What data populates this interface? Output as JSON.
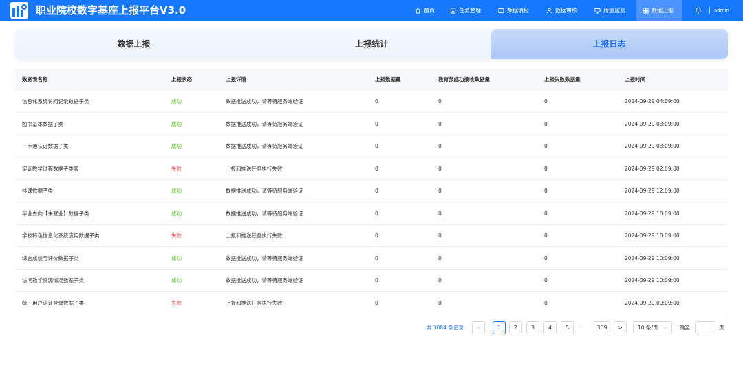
{
  "header": {
    "title": "职业院校数字基座上报平台V3.0",
    "nav": [
      {
        "label": "首页",
        "icon": "home-icon"
      },
      {
        "label": "任务管理",
        "icon": "task-icon"
      },
      {
        "label": "数据填报",
        "icon": "form-icon"
      },
      {
        "label": "数据审核",
        "icon": "user-check-icon"
      },
      {
        "label": "质量监测",
        "icon": "monitor-icon"
      },
      {
        "label": "数据上报",
        "icon": "upload-icon"
      }
    ],
    "active_nav": "数据上报",
    "user": "admin",
    "brand_color": "#1677ff"
  },
  "tabs": [
    {
      "label": "数据上报"
    },
    {
      "label": "上报统计"
    },
    {
      "label": "上报日志"
    }
  ],
  "active_tab": "上报日志",
  "table": {
    "columns": [
      "数据表名称",
      "上报状态",
      "上报详情",
      "上报数据量",
      "教育部成功接收数据量",
      "上报失败数据量",
      "上报时间"
    ],
    "rows": [
      {
        "name": "信息化系统访问记录数据子类",
        "status": "成功",
        "detail": "数据推送成功，请等待服务端验证",
        "count": "0",
        "received": "0",
        "failed": "0",
        "time": "2024-09-29 04:09:00"
      },
      {
        "name": "图书基本数据子类",
        "status": "成功",
        "detail": "数据推送成功，请等待服务端验证",
        "count": "0",
        "received": "0",
        "failed": "0",
        "time": "2024-09-29 03:09:00"
      },
      {
        "name": "一卡通认证数据子类",
        "status": "成功",
        "detail": "数据推送成功，请等待服务端验证",
        "count": "0",
        "received": "0",
        "failed": "0",
        "time": "2024-09-29 03:09:00"
      },
      {
        "name": "实训教学过程数据子类表",
        "status": "失败",
        "detail": "上报和推送任务执行失败",
        "count": "0",
        "received": "0",
        "failed": "0",
        "time": "2024-09-29 02:09:00"
      },
      {
        "name": "排课数据子类",
        "status": "成功",
        "detail": "数据推送成功，请等待服务端验证",
        "count": "0",
        "received": "0",
        "failed": "0",
        "time": "2024-09-29 12:09:00"
      },
      {
        "name": "毕业去向【未就业】数据子类",
        "status": "成功",
        "detail": "数据推送成功，请等待服务端验证",
        "count": "0",
        "received": "0",
        "failed": "0",
        "time": "2024-09-29 10:09:00"
      },
      {
        "name": "学校特色信息化系统应用数据子类",
        "status": "失败",
        "detail": "上报和推送任务执行失败",
        "count": "0",
        "received": "0",
        "failed": "0",
        "time": "2024-09-29 10:09:00"
      },
      {
        "name": "综合成绩与评价数据子类",
        "status": "成功",
        "detail": "数据推送成功，请等待服务端验证",
        "count": "0",
        "received": "0",
        "failed": "0",
        "time": "2024-09-29 10:09:00"
      },
      {
        "name": "访问教学资源情况数据子类",
        "status": "成功",
        "detail": "数据推送成功，请等待服务端验证",
        "count": "0",
        "received": "0",
        "failed": "0",
        "time": "2024-09-29 10:09:00"
      },
      {
        "name": "统一用户认证登录数据子类",
        "status": "失败",
        "detail": "上报和推送任务执行失败",
        "count": "0",
        "received": "0",
        "failed": "0",
        "time": "2024-09-29 09:09:00"
      }
    ],
    "status_colors": {
      "成功": "#52c41a",
      "失败": "#ff4d4f"
    }
  },
  "pagination": {
    "total_text": "共 3084 条记录",
    "prev": "<",
    "next": ">",
    "pages": [
      "1",
      "2",
      "3",
      "4",
      "5"
    ],
    "ellipsis": "···",
    "last_page": "309",
    "current_page": "1",
    "page_size": "10 条/页",
    "goto_label": "跳至",
    "page_unit": "页"
  }
}
